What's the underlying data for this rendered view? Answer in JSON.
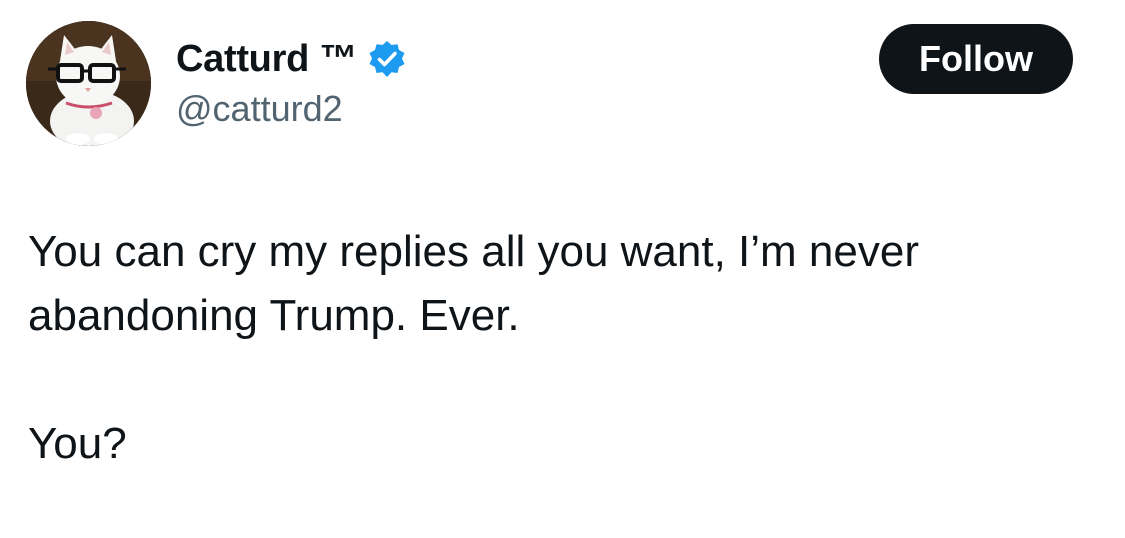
{
  "author": {
    "display_name": "Catturd ™",
    "handle": "@catturd2",
    "avatar_icon": "cat-with-glasses-avatar",
    "verified_icon": "verified-badge-icon",
    "verified_color": "#1d9bf0"
  },
  "actions": {
    "follow_label": "Follow"
  },
  "tweet": {
    "line1": "You can cry my replies all you want, I’m never",
    "line2": "abandoning Trump. Ever.",
    "line3": "You?"
  },
  "colors": {
    "text": "#0f1419",
    "secondary_text": "#536471",
    "button_bg": "#0f1419",
    "button_text": "#ffffff",
    "background": "#ffffff"
  }
}
